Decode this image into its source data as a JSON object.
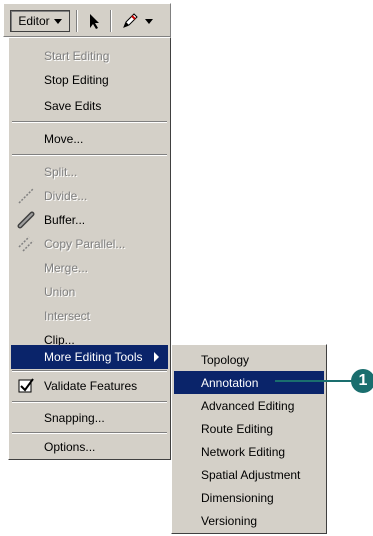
{
  "toolbar": {
    "editor_label": "Editor",
    "icons": [
      "edit-arrow-icon",
      "sketch-pencil-icon"
    ]
  },
  "menu": {
    "items": [
      {
        "label": "Start Editing",
        "enabled": false
      },
      {
        "label": "Stop Editing",
        "enabled": true
      },
      {
        "label": "Save Edits",
        "enabled": true
      },
      {
        "label": "Move...",
        "enabled": true
      },
      {
        "label": "Split...",
        "enabled": false
      },
      {
        "label": "Divide...",
        "enabled": false,
        "icon": "divide-icon"
      },
      {
        "label": "Buffer...",
        "enabled": true,
        "icon": "buffer-icon"
      },
      {
        "label": "Copy Parallel...",
        "enabled": false,
        "icon": "copy-parallel-icon"
      },
      {
        "label": "Merge...",
        "enabled": false
      },
      {
        "label": "Union",
        "enabled": false
      },
      {
        "label": "Intersect",
        "enabled": false
      },
      {
        "label": "Clip...",
        "enabled": true
      },
      {
        "label": "More Editing Tools",
        "enabled": true,
        "highlighted": true,
        "submenu": true
      },
      {
        "label": "Validate Features",
        "enabled": true,
        "icon": "validate-features-icon"
      },
      {
        "label": "Snapping...",
        "enabled": true
      },
      {
        "label": "Options...",
        "enabled": true
      }
    ]
  },
  "submenu": {
    "items": [
      {
        "label": "Topology"
      },
      {
        "label": "Annotation",
        "highlighted": true
      },
      {
        "label": "Advanced Editing"
      },
      {
        "label": "Route Editing"
      },
      {
        "label": "Network Editing"
      },
      {
        "label": "Spatial Adjustment"
      },
      {
        "label": "Dimensioning"
      },
      {
        "label": "Versioning"
      }
    ]
  },
  "callout": {
    "number": "1"
  },
  "colors": {
    "highlight": "#0a246a",
    "callout": "#1a6e6e",
    "menu_bg": "#d4d0c8"
  }
}
